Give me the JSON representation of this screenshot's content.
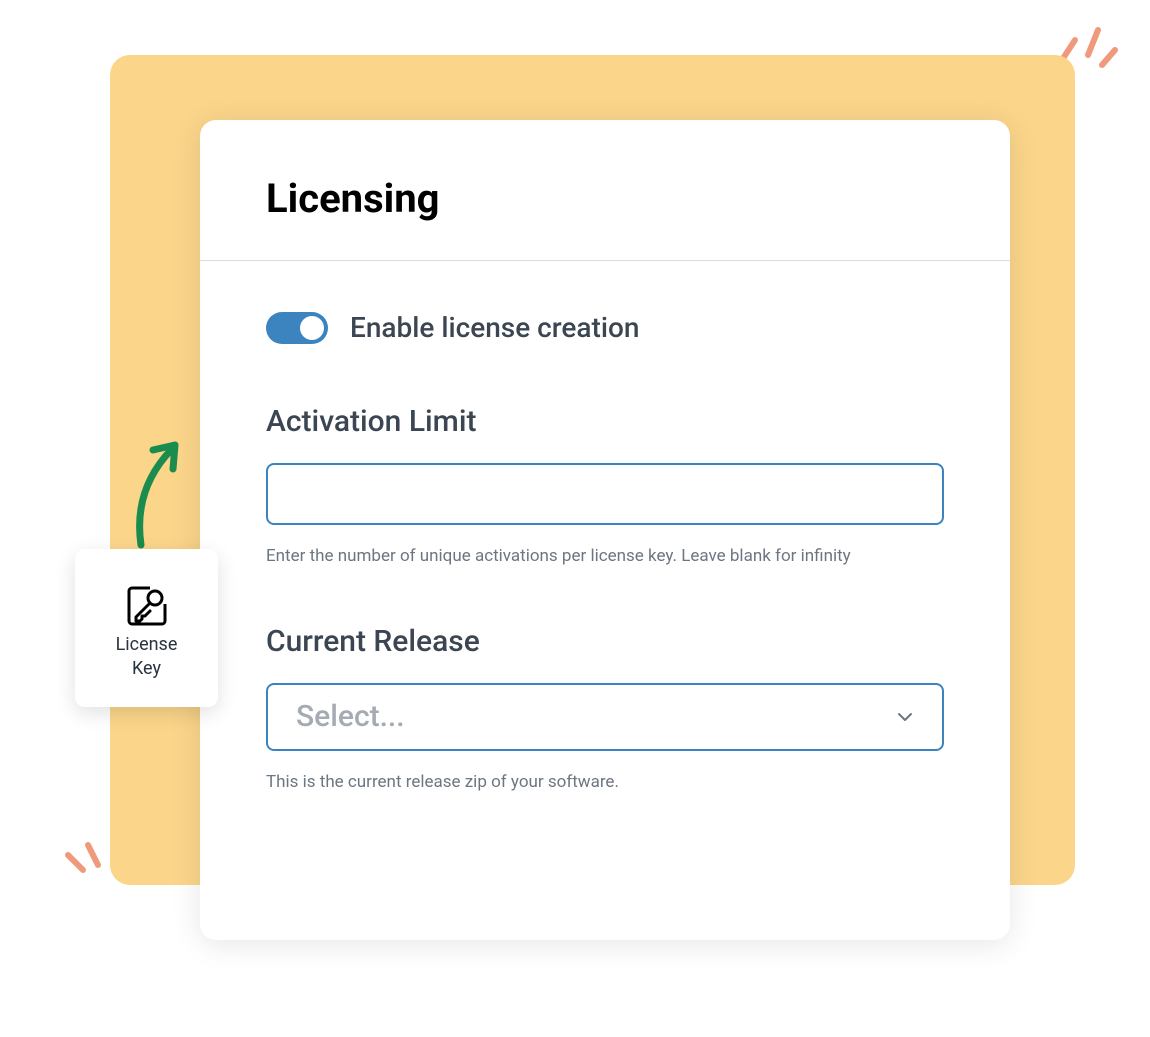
{
  "card": {
    "title": "Licensing",
    "toggle_label": "Enable license creation",
    "toggle_on": true,
    "activation_label": "Activation Limit",
    "activation_value": "",
    "activation_helper": "Enter the number of unique activations per license key. Leave blank for infinity",
    "release_label": "Current Release",
    "release_placeholder": "Select...",
    "release_helper": "This is the current release zip of your software."
  },
  "badge": {
    "line1": "License",
    "line2": "Key"
  },
  "colors": {
    "accent": "#3c84bf",
    "yellow": "#fbd58a",
    "orange": "#ef9a7d",
    "green": "#1a8c4d"
  }
}
